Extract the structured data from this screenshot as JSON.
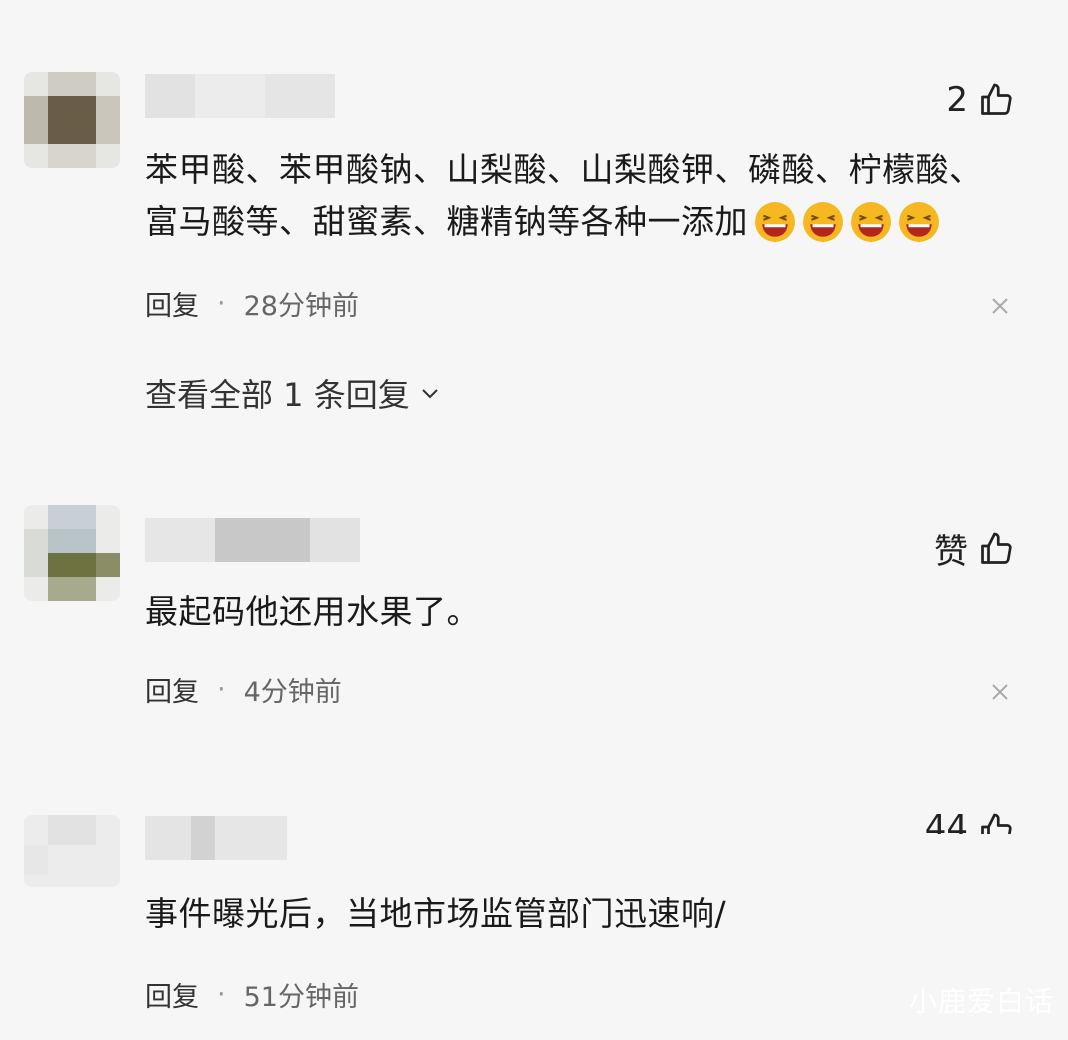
{
  "comments": [
    {
      "likes": "2",
      "text_line1": "苯甲酸、苯甲酸钠、山梨酸、山梨酸钾、磷酸、柠檬酸、",
      "text_line2": "富马酸等、甜蜜素、糖精钠等各种一添加",
      "reply_label": "回复",
      "dot": "·",
      "time": "28分钟前",
      "view_replies": "查看全部 1 条回复"
    },
    {
      "likes": "赞",
      "text_line1": "最起码他还用水果了。",
      "reply_label": "回复",
      "dot": "·",
      "time": "4分钟前"
    },
    {
      "likes": "44",
      "text_line1": "事件曝光后，当地市场监管部门迅速响/",
      "reply_label": "回复",
      "dot": "·",
      "time": "51分钟前"
    }
  ],
  "emoji_icon": "laughing-emoji",
  "watermark": "小鹿爱白话",
  "colors": {
    "background": "#f6f6f6",
    "text": "#1a1a1a",
    "meta": "#666666",
    "emoji": "#f6b820"
  }
}
